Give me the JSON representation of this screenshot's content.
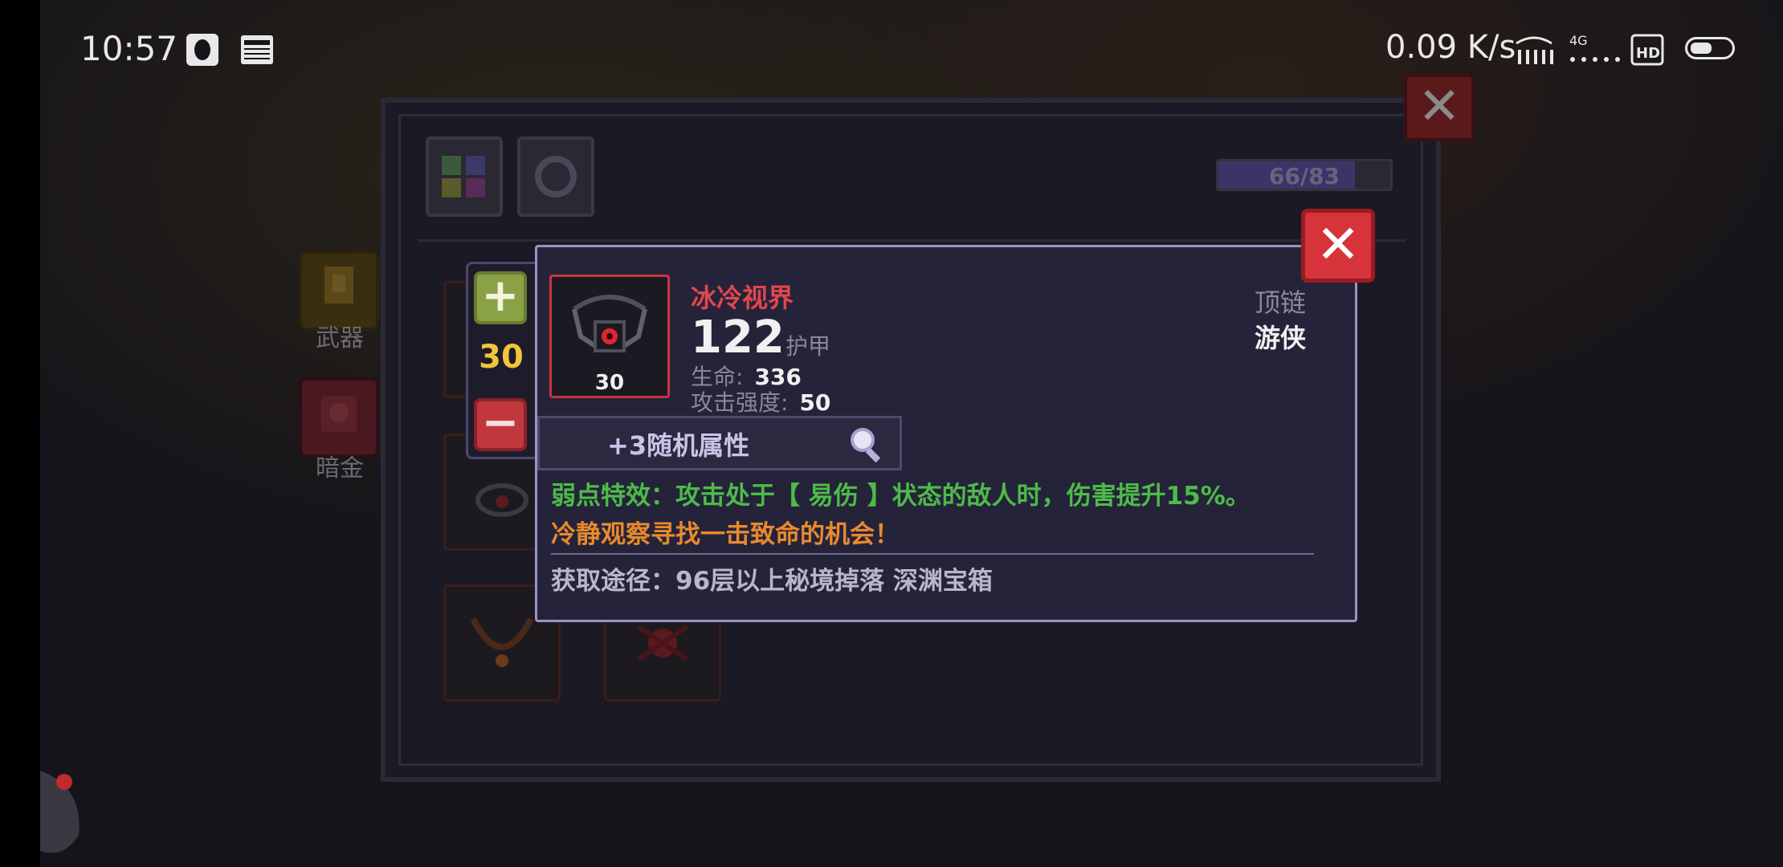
{
  "status_bar": {
    "time": "10:57",
    "network_speed": "0.09 K/s",
    "network_type": "4G",
    "hd_label": "HD",
    "news_label": "NEWS"
  },
  "inventory": {
    "capacity": "66/83",
    "capacity_used": 66,
    "capacity_total": 83,
    "side_buttons": [
      "武器",
      "暗金"
    ]
  },
  "item": {
    "level": "30",
    "name": "冰冷视界",
    "armor_value": "122",
    "armor_label": "护甲",
    "stats": [
      {
        "label": "生命:",
        "value": "336"
      },
      {
        "label": "攻击强度:",
        "value": "50"
      }
    ],
    "slot_type": "顶链",
    "class": "游侠",
    "random_attrs": "+3随机属性",
    "effect": "弱点特效：攻击处于【 易伤 】状态的敌人时，伤害提升15%。",
    "flavor": "冷静观察寻找一击致命的机会！",
    "source": "获取途径：96层以上秘境掉落 深渊宝箱"
  },
  "controls": {
    "plus": "+",
    "minus": "−",
    "close": "✕"
  },
  "colors": {
    "item_name": "#e2464c",
    "effect": "#4dbb48",
    "flavor": "#e88a2c",
    "level": "#f2c53a",
    "tooltip_border": "#9b93c4",
    "close_button": "#d6343a"
  }
}
